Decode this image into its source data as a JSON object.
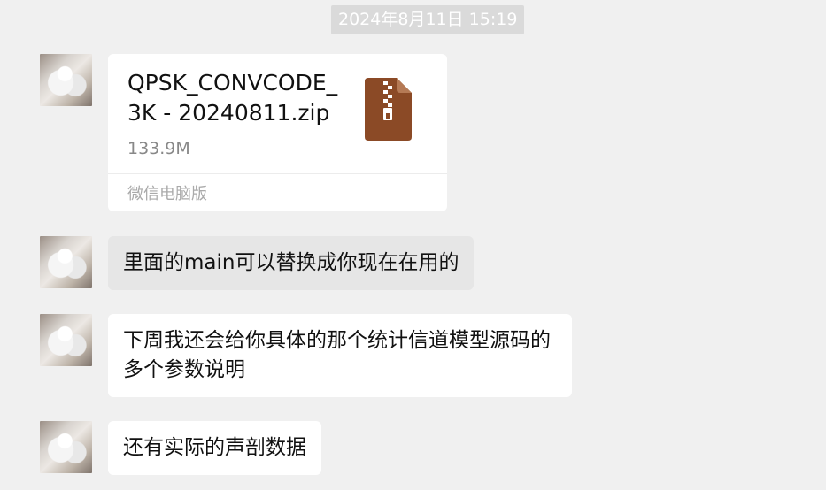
{
  "timestamp": "2024年8月11日 15:19",
  "messages": [
    {
      "type": "file",
      "file_name": "QPSK_CONVCODE_3K - 20240811.zip",
      "file_size": "133.9M",
      "source": "微信电脑版",
      "icon": "zip-file-icon",
      "icon_color": "#8b4a26"
    },
    {
      "type": "text",
      "text": "里面的main可以替换成你现在在用的"
    },
    {
      "type": "text",
      "text": "下周我还会给你具体的那个统计信道模型源码的多个参数说明"
    },
    {
      "type": "text",
      "text": "还有实际的声剖数据"
    }
  ]
}
